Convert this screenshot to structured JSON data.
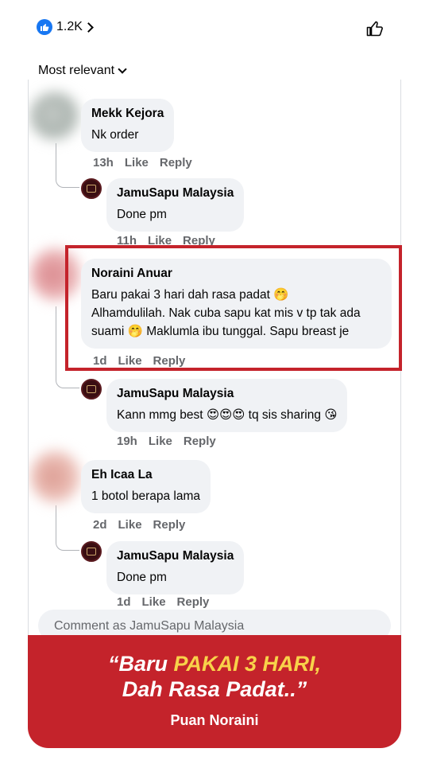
{
  "top": {
    "like_count": "1.2K",
    "sort_label": "Most relevant"
  },
  "comments": [
    {
      "author": "Mekk Kejora",
      "text": "Nk order",
      "time": "13h",
      "like": "Like",
      "reply": "Reply",
      "replies": [
        {
          "author": "JamuSapu Malaysia",
          "text": "Done pm",
          "time": "11h",
          "like": "Like",
          "reply": "Reply"
        }
      ]
    },
    {
      "author": "Noraini Anuar",
      "text_lines": [
        "Baru pakai 3 hari dah rasa padat 🤭",
        "Alhamdulilah. Nak cuba sapu kat mis v tp tak ada",
        "suami 🤭 Maklumla ibu tunggal. Sapu breast je"
      ],
      "time": "1d",
      "like": "Like",
      "reply": "Reply",
      "replies": [
        {
          "author": "JamuSapu Malaysia",
          "text": "Kann mmg best 😍😍😍 tq sis sharing 😘",
          "time": "19h",
          "like": "Like",
          "reply": "Reply"
        }
      ]
    },
    {
      "author": "Eh Icaa La",
      "text": "1 botol berapa lama",
      "time": "2d",
      "like": "Like",
      "reply": "Reply",
      "replies": [
        {
          "author": "JamuSapu Malaysia",
          "text": "Done pm",
          "time": "1d",
          "like": "Like",
          "reply": "Reply"
        }
      ]
    }
  ],
  "composer": {
    "placeholder": "Comment as JamuSapu Malaysia"
  },
  "banner": {
    "quote_part1": "“Baru ",
    "quote_highlight": "PAKAI 3 HARI,",
    "quote_line2": "Dah Rasa Padat..”",
    "author": "Puan Noraini"
  },
  "colors": {
    "accent_red": "#c4232b",
    "highlight_yellow": "#f8d24a",
    "facebook_blue": "#1877f2",
    "bubble_gray": "#f0f2f5",
    "meta_gray": "#65676b"
  },
  "icons": [
    "like-badge-icon",
    "chevron-right-icon",
    "thumbs-up-icon",
    "chevron-down-icon",
    "brand-avatar-icon"
  ]
}
